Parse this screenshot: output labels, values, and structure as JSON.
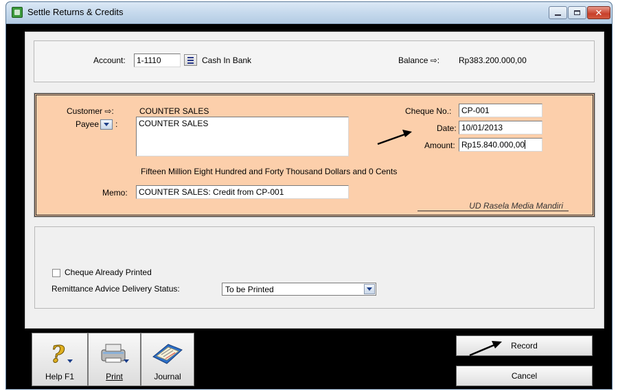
{
  "window": {
    "title": "Settle Returns & Credits"
  },
  "account": {
    "label": "Account:",
    "number": "1-1110",
    "name": "Cash In Bank",
    "balance_label": "Balance ⇨:",
    "balance_value": "Rp383.200.000,00"
  },
  "details": {
    "customer_label": "Customer ⇨:",
    "customer_value": "COUNTER SALES",
    "payee_label": "Payee",
    "payee_colon": ":",
    "payee_value": "COUNTER SALES",
    "cheque_label": "Cheque No.:",
    "cheque_value": "CP-001",
    "date_label": "Date:",
    "date_value": "10/01/2013",
    "amount_label": "Amount:",
    "amount_value": "Rp15.840.000,00",
    "amount_words": "Fifteen Million Eight Hundred and Forty Thousand Dollars and 0 Cents",
    "memo_label": "Memo:",
    "memo_value": "COUNTER SALES:  Credit from CP-001",
    "company_signature": "UD Rasela Media Mandiri"
  },
  "options": {
    "cheque_printed_label": "Cheque Already Printed",
    "cheque_printed_checked": false,
    "remittance_label": "Remittance Advice Delivery Status:",
    "remittance_value": "To be Printed"
  },
  "toolbar": {
    "help_label": "Help F1",
    "print_label": "Print",
    "journal_label": "Journal"
  },
  "actions": {
    "record_label": "Record",
    "cancel_label": "Cancel"
  },
  "colors": {
    "detail_panel_bg": "#fccfab",
    "window_frame": "#000000"
  }
}
